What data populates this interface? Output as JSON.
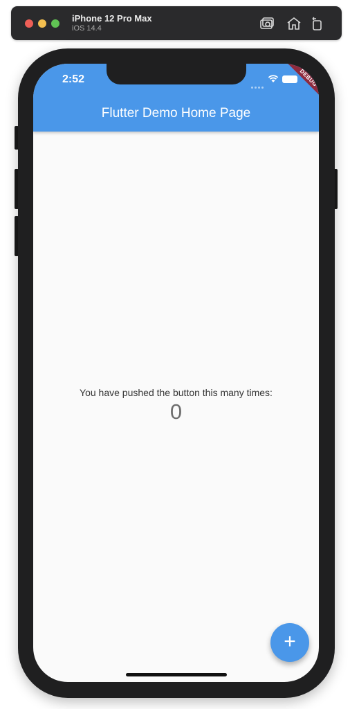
{
  "simulator": {
    "device_name": "iPhone 12 Pro Max",
    "os_version": "iOS 14.4",
    "toolbar_icons": [
      "screenshot-icon",
      "home-icon",
      "rotate-icon"
    ]
  },
  "status_bar": {
    "time": "2:52"
  },
  "app_bar": {
    "title": "Flutter Demo Home Page",
    "color": "#4a97e9"
  },
  "debug_banner": {
    "label": "DEBUG",
    "color": "#8f2b3e"
  },
  "body": {
    "counter_label": "You have pushed the button this many times:",
    "counter_value": "0"
  },
  "fab": {
    "label": "+",
    "icon": "plus-icon"
  }
}
